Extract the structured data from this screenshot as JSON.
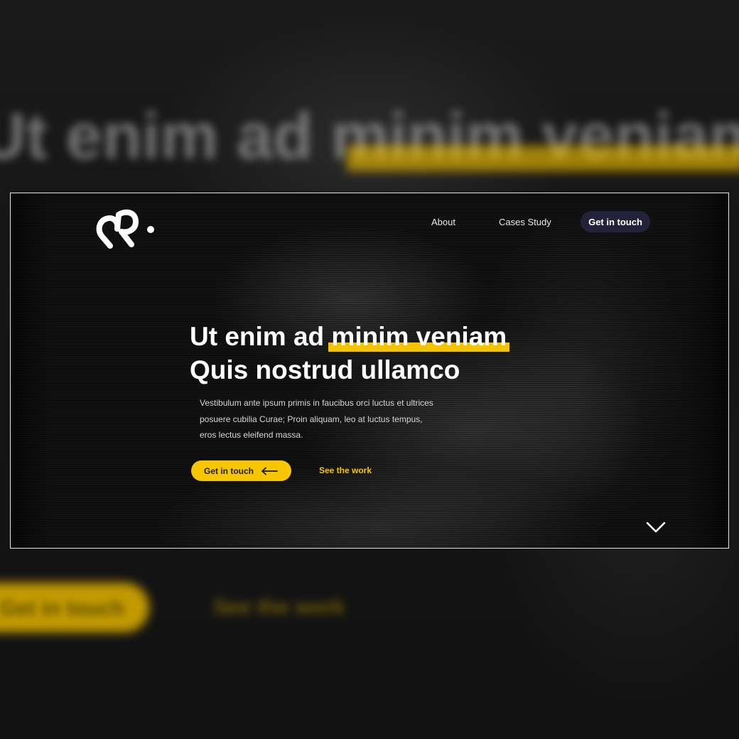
{
  "background": {
    "headline_fragment": "Ut enim ad minim veniam",
    "cta_fragment": "Get in touch",
    "link_fragment": "See the work"
  },
  "nav": {
    "logo_text": "R.",
    "about_label": "About",
    "cases_label": "Cases Study",
    "cta_label": "Get in touch"
  },
  "hero": {
    "headline_line1_prefix": "Ut enim ad ",
    "headline_line1_highlight": "minim veniam",
    "headline_line2": "Quis nostrud ullamco",
    "body_line1": "Vestibulum ante ipsum primis in faucibus orci luctus et ultrices",
    "body_line2": "posuere cubilia Curae; Proin aliquam, leo at luctus tempus,",
    "body_line3": "eros lectus eleifend massa.",
    "primary_cta_label": "Get in touch",
    "secondary_cta_label": "See the work"
  },
  "icons": {
    "cta_arrow": "arrow-left-icon",
    "scroll": "chevron-down-icon"
  },
  "colors": {
    "accent": "#f5c400",
    "nav_cta_bg": "#22233a",
    "background": "#121212"
  }
}
